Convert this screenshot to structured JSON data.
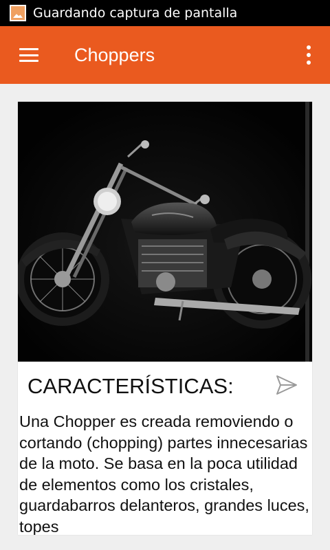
{
  "status_bar": {
    "icon": "image-icon",
    "text": "Guardando captura de pantalla"
  },
  "app_bar": {
    "title": "Choppers",
    "menu_icon": "hamburger-menu-icon",
    "overflow_icon": "overflow-menu-icon",
    "color": "#ea5a1f"
  },
  "card": {
    "image_subject": "black chopper motorcycle",
    "heading": "CARACTERÍSTICAS:",
    "share_icon": "send-icon",
    "body": "Una Chopper es creada removiendo o cortando (chopping) partes innecesarias de la moto. Se basa en la poca utilidad de elementos como los cristales, guardabarros delanteros, grandes luces, topes"
  }
}
